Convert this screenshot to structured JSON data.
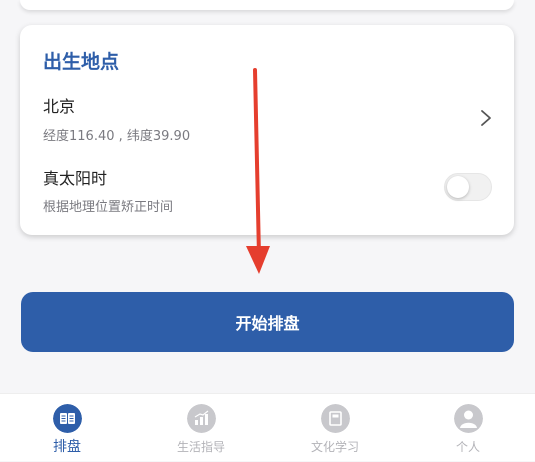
{
  "birth_place": {
    "section_title": "出生地点",
    "city": "北京",
    "coordinates": "经度116.40 , 纬度39.90"
  },
  "true_solar_time": {
    "title": "真太阳时",
    "description": "根据地理位置矫正时间",
    "enabled": false
  },
  "start_button": {
    "label": "开始排盘"
  },
  "tabbar": {
    "items": [
      {
        "label": "排盘",
        "icon": "book-icon",
        "active": true
      },
      {
        "label": "生活指导",
        "icon": "chart-icon",
        "active": false
      },
      {
        "label": "文化学习",
        "icon": "notebook-icon",
        "active": false
      },
      {
        "label": "个人",
        "icon": "user-icon",
        "active": false
      }
    ]
  },
  "colors": {
    "accent": "#2e5ea9",
    "arrow": "#e53e2e",
    "inactive": "#b3b3b8"
  }
}
